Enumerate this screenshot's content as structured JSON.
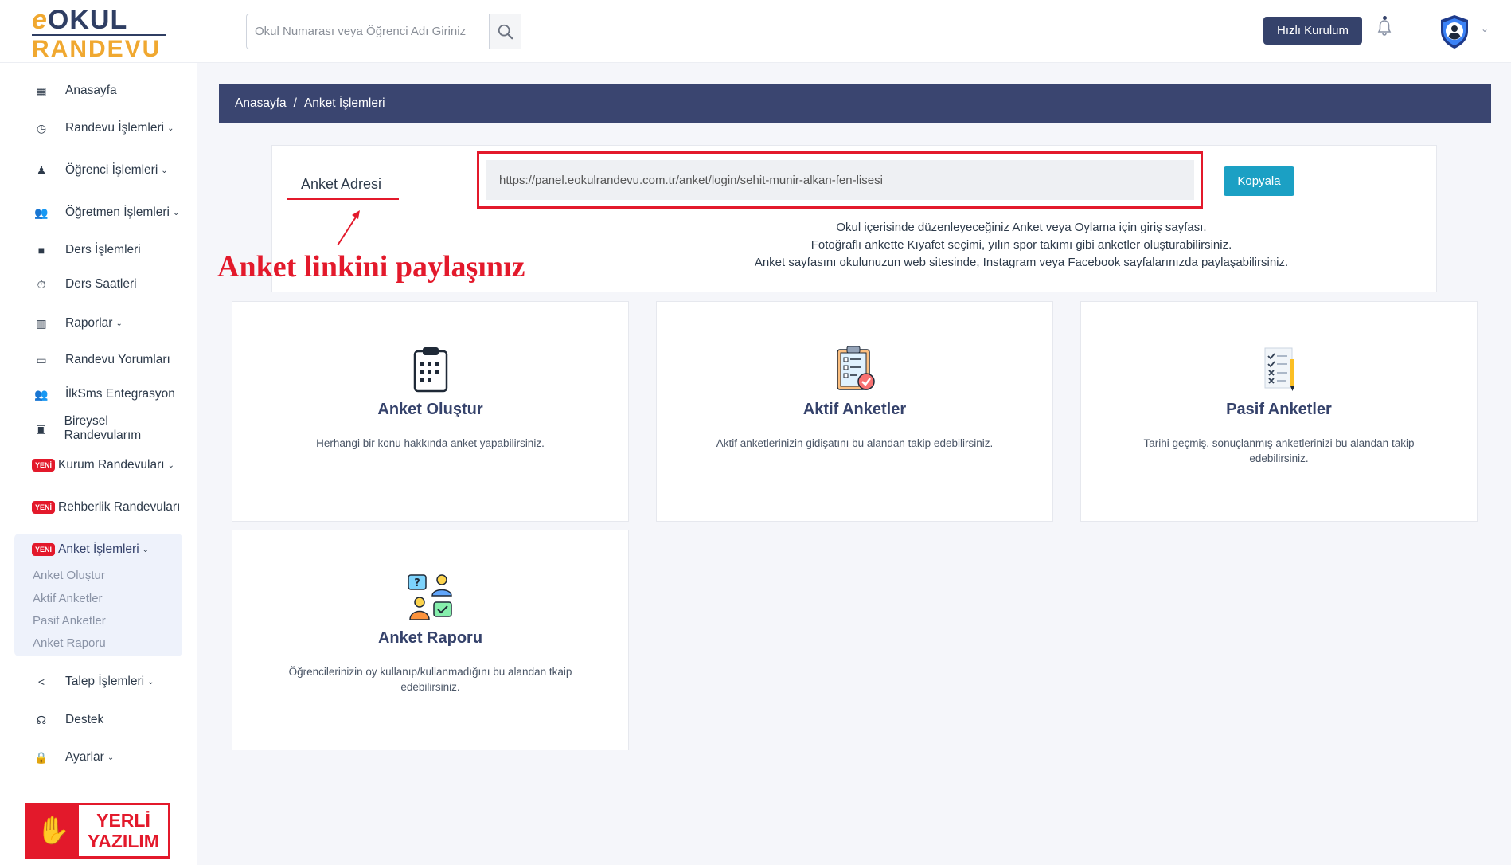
{
  "logo": {
    "e": "e",
    "top": "OKUL",
    "bottom": "RANDEVU"
  },
  "search": {
    "placeholder": "Okul Numarası veya Öğrenci Adı Giriniz"
  },
  "header": {
    "quick_setup": "Hızlı Kurulum"
  },
  "sidebar": {
    "items": [
      {
        "label": "Anasayfa",
        "icon": "dashboard-icon"
      },
      {
        "label": "Randevu İşlemleri",
        "icon": "calendar-clock-icon"
      },
      {
        "label": "Öğrenci İşlemleri",
        "icon": "student-icon"
      },
      {
        "label": "Öğretmen İşlemleri",
        "icon": "users-icon"
      },
      {
        "label": "Ders İşlemleri",
        "icon": "folder-icon"
      },
      {
        "label": "Ders Saatleri",
        "icon": "stopwatch-icon"
      },
      {
        "label": "Raporlar",
        "icon": "bar-chart-icon"
      },
      {
        "label": "Randevu Yorumları",
        "icon": "comment-icon"
      },
      {
        "label": "İlkSms Entegrasyon",
        "icon": "users-icon"
      },
      {
        "label": "Bireysel Randevularım",
        "icon": "calendar-icon"
      },
      {
        "label": "Kurum Randevuları"
      },
      {
        "label": "Rehberlik Randevuları"
      },
      {
        "label": "Anket İşlemleri"
      },
      {
        "label": "Talep İşlemleri",
        "icon": "share-icon"
      },
      {
        "label": "Destek",
        "icon": "support-icon"
      },
      {
        "label": "Ayarlar",
        "icon": "lock-icon"
      }
    ],
    "new_badge": "YENİ",
    "sub_items": [
      "Anket Oluştur",
      "Aktif Anketler",
      "Pasif Anketler",
      "Anket Raporu"
    ],
    "yerli": {
      "line1": "YERLİ",
      "line2": "YAZILIM"
    }
  },
  "breadcrumb": {
    "home": "Anasayfa",
    "sep": "/",
    "current": "Anket İşlemleri"
  },
  "address": {
    "label": "Anket Adresi",
    "url": "https://panel.eokulrandevu.com.tr/anket/login/sehit-munir-alkan-fen-lisesi",
    "copy": "Kopyala",
    "desc1": "Okul içerisinde düzenleyeceğiniz Anket veya Oylama için giriş sayfası.",
    "desc2": "Fotoğraflı ankette Kıyafet seçimi, yılın spor takımı gibi anketler oluşturabilirsiniz.",
    "desc3": "Anket sayfasını okulunuzun web sitesinde, Instagram veya Facebook sayfalarınızda paylaşabilirsiniz."
  },
  "annotation": "Anket linkini paylaşınız",
  "cards": [
    {
      "title": "Anket Oluştur",
      "desc": "Herhangi bir konu hakkında anket yapabilirsiniz."
    },
    {
      "title": "Aktif Anketler",
      "desc": "Aktif anketlerinizin gidişatını bu alandan takip edebilirsiniz."
    },
    {
      "title": "Pasif Anketler",
      "desc": "Tarihi geçmiş, sonuçlanmış anketlerinizi bu alandan takip edebilirsiniz."
    },
    {
      "title": "Anket Raporu",
      "desc": "Öğrencilerinizin oy kullanıp/kullanmadığını bu alandan tkaip edebilirsiniz."
    }
  ],
  "colors": {
    "primary": "#3a4570",
    "accent": "#e3192b",
    "info": "#1ba0c4",
    "logo_orange": "#f0a830"
  }
}
